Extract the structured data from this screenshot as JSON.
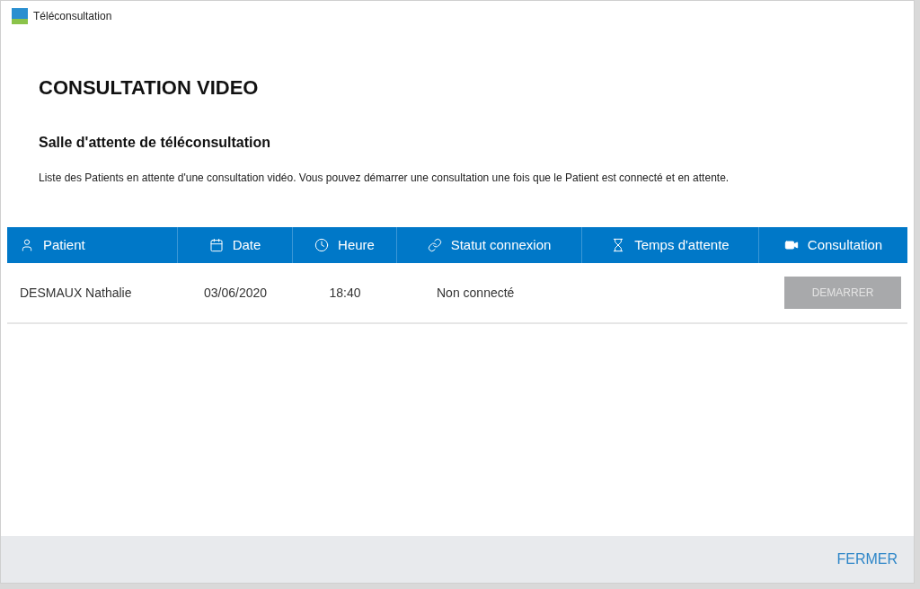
{
  "window": {
    "title": "Téléconsultation"
  },
  "heading": "CONSULTATION VIDEO",
  "subheading": "Salle d'attente de téléconsultation",
  "description": "Liste des Patients en attente d'une consultation vidéo. Vous pouvez démarrer une consultation une fois que le Patient est connecté et en attente.",
  "table": {
    "columns": [
      {
        "label": "Patient",
        "kind": "user"
      },
      {
        "label": "Date",
        "kind": "calendar"
      },
      {
        "label": "Heure",
        "kind": "clock"
      },
      {
        "label": "Statut connexion",
        "kind": "link"
      },
      {
        "label": "Temps d'attente",
        "kind": "hourglass"
      },
      {
        "label": "Consultation",
        "kind": "video"
      }
    ],
    "rows": [
      {
        "patient": "DESMAUX Nathalie",
        "date": "03/06/2020",
        "heure": "18:40",
        "statut": "Non connecté",
        "button": {
          "label": "DEMARRER",
          "disabled": true
        }
      }
    ]
  },
  "footer": {
    "button": "FERMER"
  }
}
